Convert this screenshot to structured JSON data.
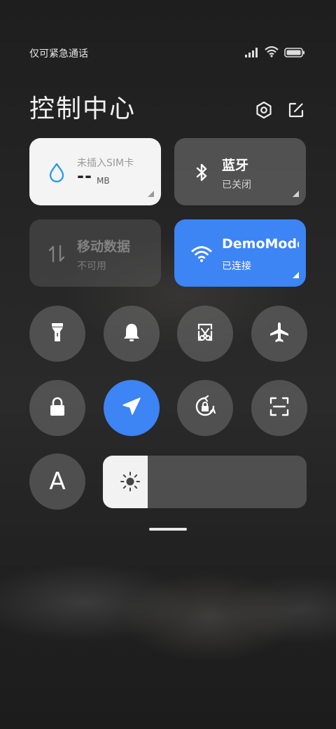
{
  "status_bar": {
    "carrier_text": "仅可紧急通话"
  },
  "header": {
    "title": "控制中心"
  },
  "tiles": {
    "sim": {
      "sub": "未插入SIM卡",
      "value": "--",
      "unit": "MB"
    },
    "bluetooth": {
      "label": "蓝牙",
      "status": "已关闭"
    },
    "mobile_data": {
      "label": "移动数据",
      "status": "不可用"
    },
    "wifi": {
      "label": "DemoMode",
      "status": "已连接"
    }
  },
  "font_button": {
    "label": "A"
  },
  "brightness": {
    "level": 0.22
  },
  "colors": {
    "accent": "#3d84f5",
    "tile_bg": "#787878",
    "sim_tile_bg": "#f4f4f4"
  }
}
